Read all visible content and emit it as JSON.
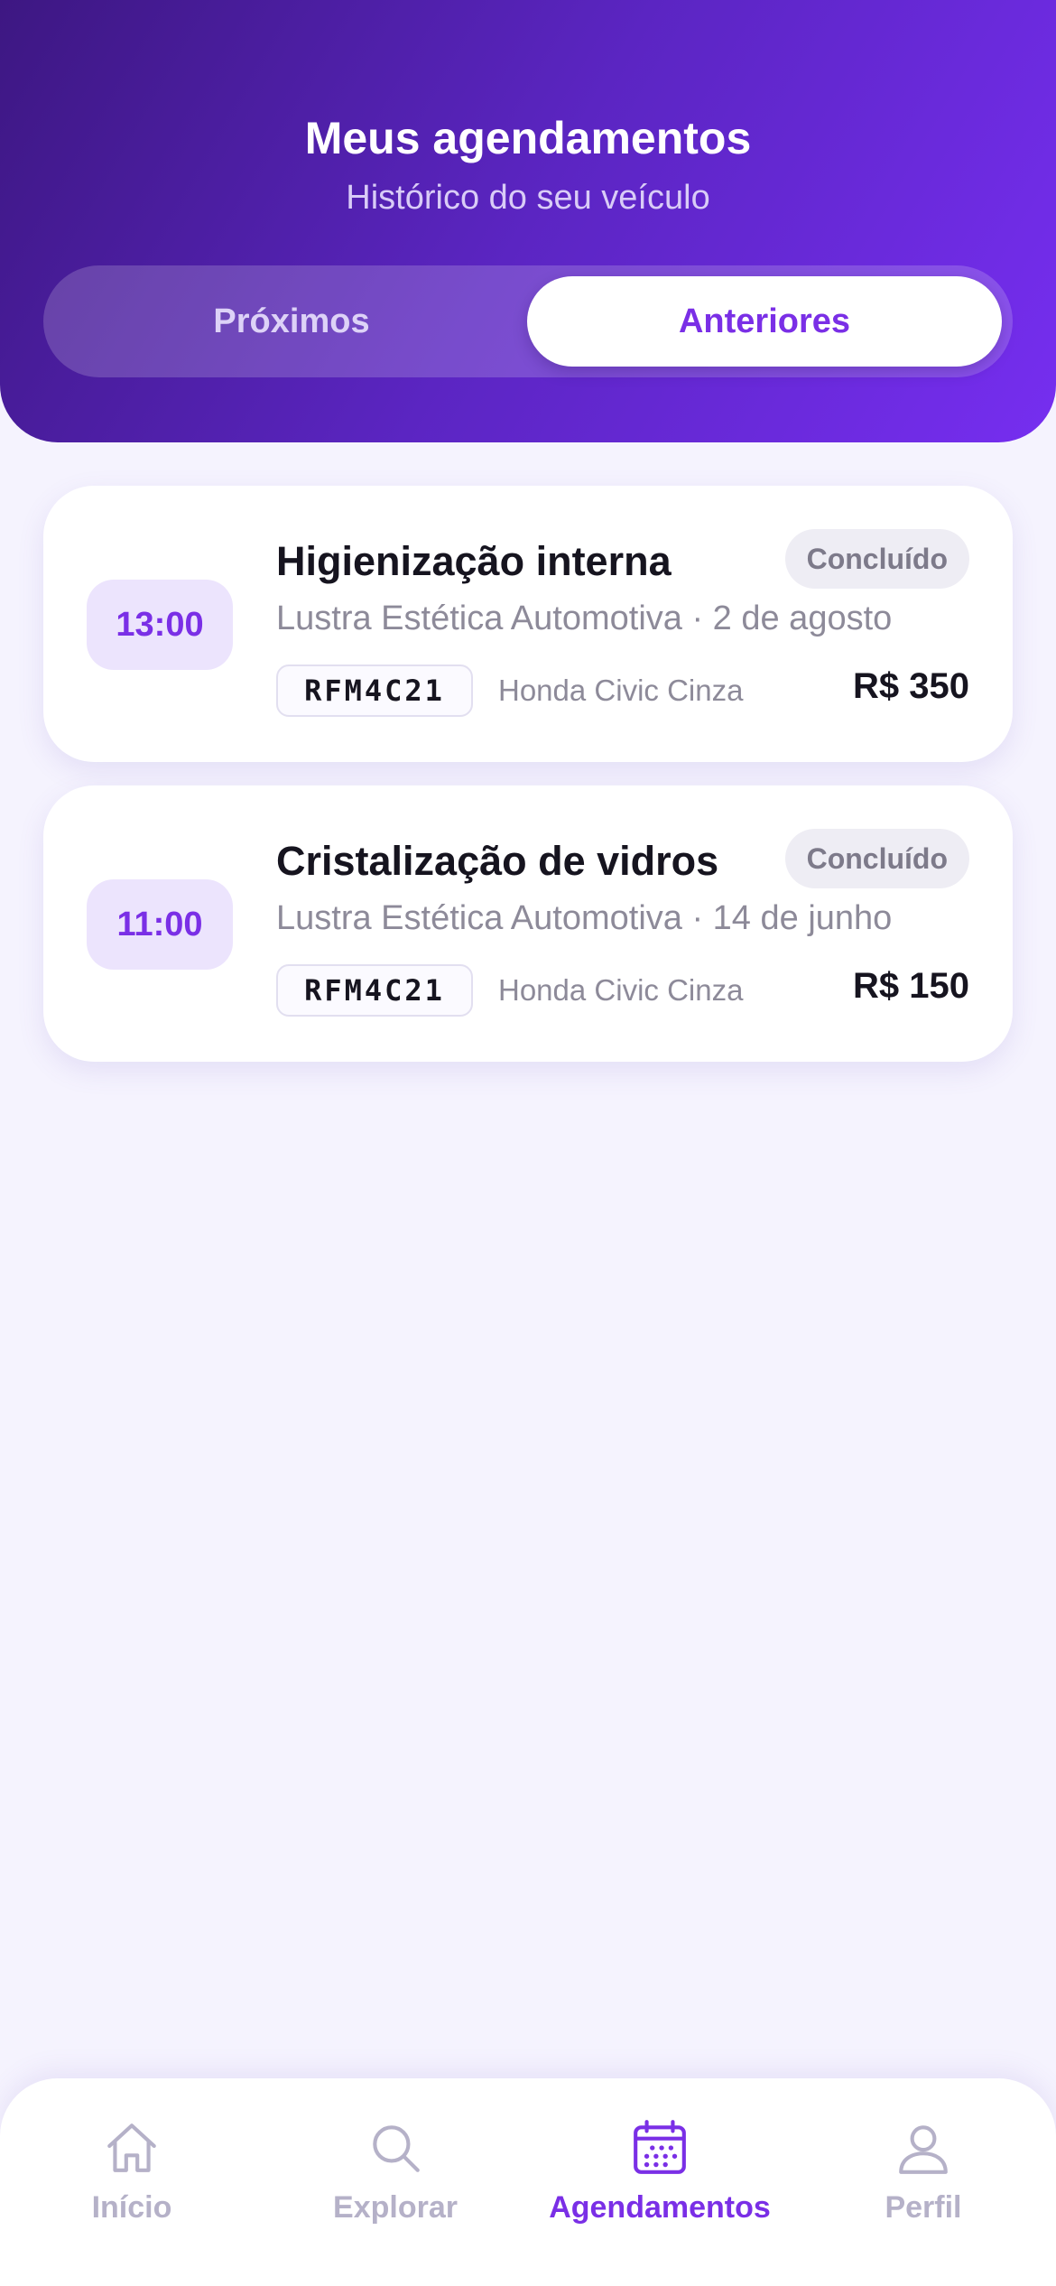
{
  "header": {
    "title": "Meus agendamentos",
    "subtitle": "Histórico do seu veículo",
    "tabs": [
      {
        "label": "Próximos",
        "selected": false
      },
      {
        "label": "Anteriores",
        "selected": true
      }
    ]
  },
  "appointments": [
    {
      "time": "13:00",
      "service": "Higienização interna",
      "status": "Concluído",
      "shop_and_date": "Lustra Estética Automotiva · 2 de agosto",
      "plate": "RFM4C21",
      "vehicle": "Honda Civic Cinza",
      "price": "R$ 350"
    },
    {
      "time": "11:00",
      "service": "Cristalização de vidros",
      "status": "Concluído",
      "shop_and_date": "Lustra Estética Automotiva · 14 de junho",
      "plate": "RFM4C21",
      "vehicle": "Honda Civic Cinza",
      "price": "R$ 150"
    }
  ],
  "bottom_nav": {
    "items": [
      {
        "label": "Início",
        "icon": "home-icon",
        "active": false
      },
      {
        "label": "Explorar",
        "icon": "search-icon",
        "active": false
      },
      {
        "label": "Agendamentos",
        "icon": "calendar-icon",
        "active": true
      },
      {
        "label": "Perfil",
        "icon": "user-icon",
        "active": false
      }
    ]
  },
  "colors": {
    "accent": "#7a2fe6",
    "header_gradient_start": "#3d1782",
    "header_gradient_end": "#762ef0",
    "background": "#f5f3fe",
    "status_badge_bg": "#eeedf4",
    "inactive_nav": "#b5b1c8"
  }
}
